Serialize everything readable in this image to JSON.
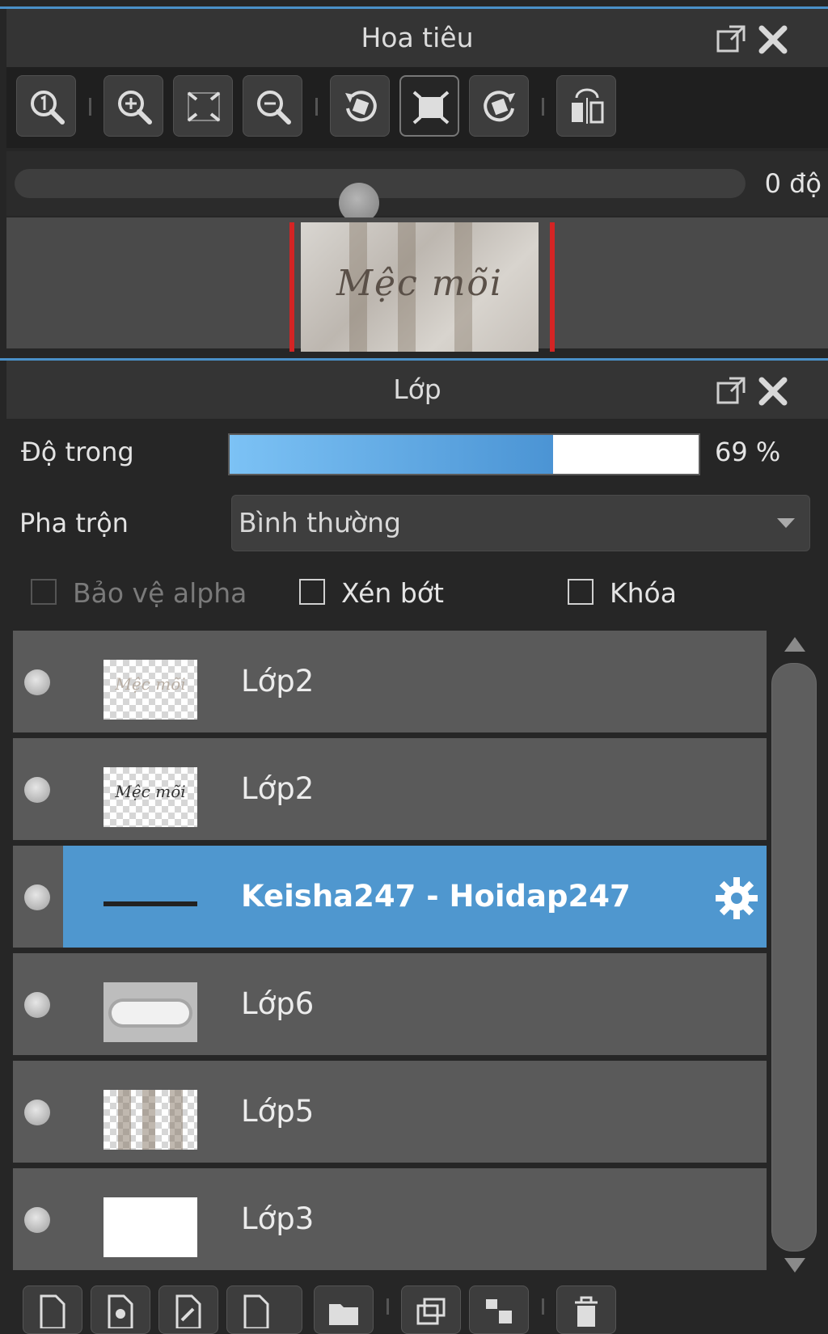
{
  "navigator": {
    "title": "Hoa tiêu",
    "popout_icon": "popout-icon",
    "close_icon": "close-icon",
    "toolbar": [
      {
        "name": "zoom-actual-button",
        "icon": "zoom-1-icon"
      },
      {
        "name": "zoom-in-button",
        "icon": "zoom-in-icon"
      },
      {
        "name": "fit-screen-button",
        "icon": "fit-screen-icon"
      },
      {
        "name": "zoom-out-button",
        "icon": "zoom-out-icon"
      },
      {
        "name": "rotate-left-button",
        "icon": "rotate-left-icon"
      },
      {
        "name": "fit-canvas-button",
        "icon": "fit-canvas-icon"
      },
      {
        "name": "rotate-right-button",
        "icon": "rotate-right-icon"
      },
      {
        "name": "flip-button",
        "icon": "flip-icon"
      }
    ],
    "rotation_value": "0 độ",
    "rotation_level": 0.47,
    "preview_text": "Mệc mõi"
  },
  "layers_panel": {
    "title": "Lớp",
    "opacity_label": "Độ trong",
    "opacity_value": "69 %",
    "opacity_fraction": 0.69,
    "blend_label": "Pha trộn",
    "blend_value": "Bình thường",
    "protect_alpha_label": "Bảo vệ alpha",
    "clip_label": "Xén bớt",
    "lock_label": "Khóa",
    "layers": [
      {
        "name": "Lớp2",
        "thumb": "faint-text",
        "selected": false
      },
      {
        "name": "Lớp2",
        "thumb": "text",
        "selected": false
      },
      {
        "name": "Keisha247 - Hoidap247",
        "thumb": "line",
        "selected": true
      },
      {
        "name": "Lớp6",
        "thumb": "cloud",
        "selected": false
      },
      {
        "name": "Lớp5",
        "thumb": "bands",
        "selected": false
      },
      {
        "name": "Lớp3",
        "thumb": "white",
        "selected": false
      }
    ],
    "selected_gear_icon": "gear-icon",
    "thumb_texts": {
      "faint": "Mệc mõi",
      "dark": "Mệc mõi"
    }
  },
  "colors": {
    "accent": "#4f97cf",
    "opacity_fill": "#5aa6e2",
    "panel_bg": "#262626",
    "header_bg": "#343434"
  }
}
